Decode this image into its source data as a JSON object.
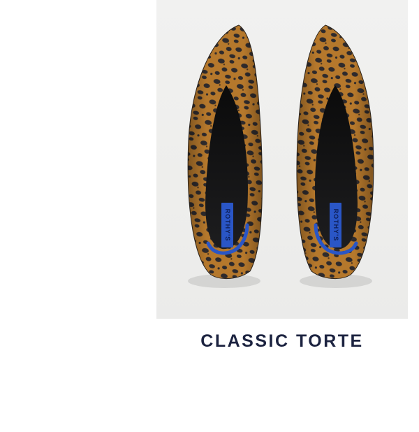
{
  "product": {
    "name": "CLASSIC TORTE",
    "insole_brand": "ROTHY'S",
    "colors": {
      "pattern_base": "#b5782c",
      "pattern_spot": "#2e2a2c",
      "lining": "#121212",
      "trim": "#2a56c6",
      "background": "#efefee",
      "name_text": "#1c2340"
    }
  }
}
